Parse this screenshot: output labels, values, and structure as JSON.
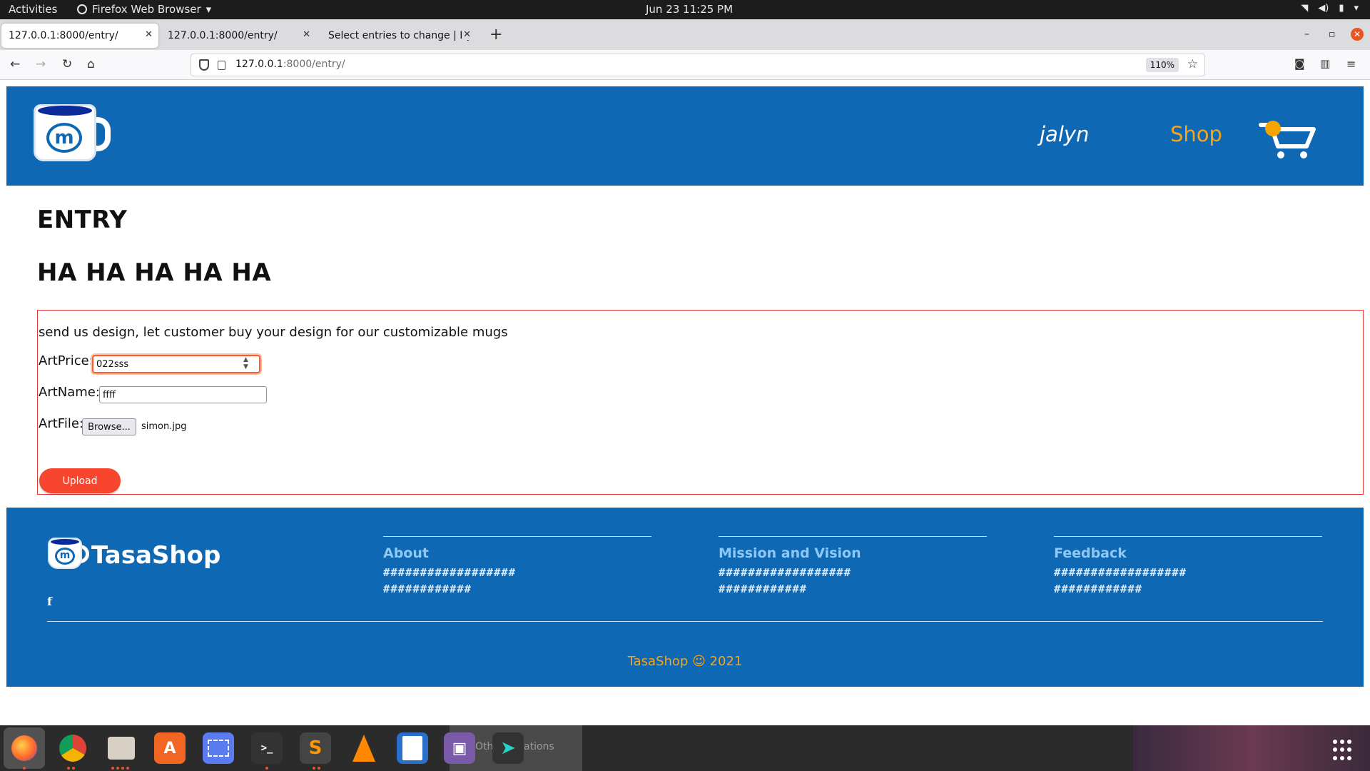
{
  "system_bar": {
    "activities": "Activities",
    "app_name": "Firefox Web Browser",
    "clock": "Jun 23  11:25 PM"
  },
  "browser": {
    "tabs": [
      {
        "title": "127.0.0.1:8000/entry/",
        "active": true
      },
      {
        "title": "127.0.0.1:8000/entry/",
        "active": false
      },
      {
        "title": "Select entries to change | Dj",
        "active": false
      }
    ],
    "url_host": "127.0.0.1",
    "url_path": ":8000/entry/",
    "zoom": "110%"
  },
  "header": {
    "logo_letter": "m",
    "user_link": "jalyn",
    "shop_link": "Shop"
  },
  "main": {
    "title": "ENTRY",
    "subtitle": "HA HA HA HA HA",
    "intro": "send us design, let customer buy your design for our customizable mugs",
    "art_price_label": "ArtPrice:",
    "art_price_value": "022sss",
    "art_name_label": "ArtName:",
    "art_name_value": "ffff",
    "art_file_label": "ArtFile:",
    "browse_label": "Browse...",
    "file_name": "simon.jpg",
    "upload_label": "Upload"
  },
  "footer": {
    "brand": "TasaShop",
    "social_icon": "f",
    "columns": [
      {
        "title": "About",
        "text": "##############################"
      },
      {
        "title": "Mission and Vision",
        "text": "##############################"
      },
      {
        "title": "Feedback",
        "text": "##############################"
      }
    ],
    "copyright": "TasaShop ☺ 2021"
  },
  "dock": {
    "other_locations": "Other Locations"
  },
  "colors": {
    "brand_blue": "#0f68b4",
    "accent_orange": "#f4a51c",
    "upload_red": "#f7462d",
    "form_border": "#e53935"
  }
}
